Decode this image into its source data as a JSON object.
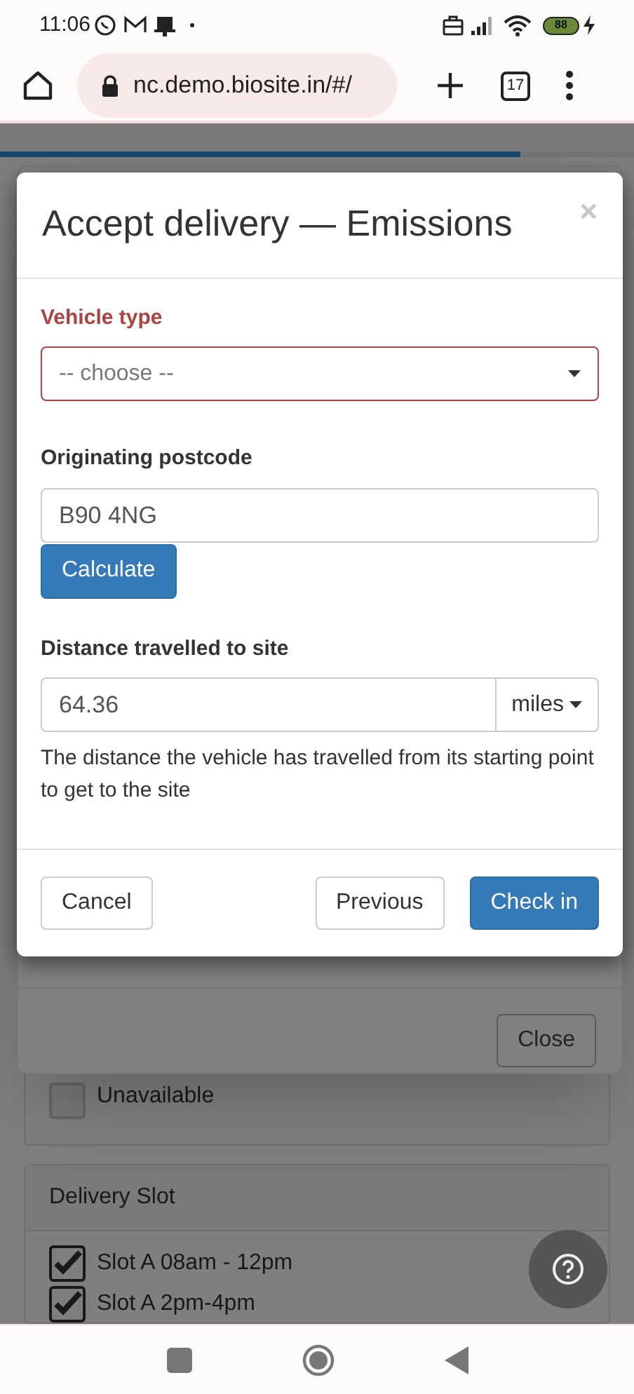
{
  "status_bar": {
    "time": "11:06",
    "battery": "88"
  },
  "browser": {
    "url": "nc.demo.biosite.in/#/",
    "tab_count": "17"
  },
  "progress": {
    "level": 0.82
  },
  "background": {
    "unavailable": {
      "label": "Unavailable",
      "checked": false
    },
    "delivery_slot": {
      "title": "Delivery Slot",
      "slots": [
        {
          "label": "Slot A 08am - 12pm",
          "checked": true
        },
        {
          "label": "Slot A 2pm-4pm",
          "checked": true
        }
      ]
    },
    "dialog": {
      "close_button": "Close"
    }
  },
  "modal": {
    "title": "Accept delivery — Emissions",
    "close": "×",
    "fields": [
      {
        "kind": "select",
        "label": "Vehicle type",
        "placeholder": "-- choose --",
        "invalid": true
      },
      {
        "kind": "text",
        "label": "Originating postcode",
        "value": "B90 4NG",
        "invalid": false,
        "button": "Calculate"
      },
      {
        "kind": "unit",
        "label": "Distance travelled to site",
        "value": "64.36",
        "unit": "miles",
        "invalid": false,
        "help": "The distance the vehicle has travelled from its starting point to get to the site"
      }
    ],
    "buttons": [
      {
        "label": "Cancel",
        "kind": "default"
      },
      {
        "label": "Previous",
        "kind": "default"
      },
      {
        "label": "Check in",
        "kind": "primary"
      }
    ]
  }
}
